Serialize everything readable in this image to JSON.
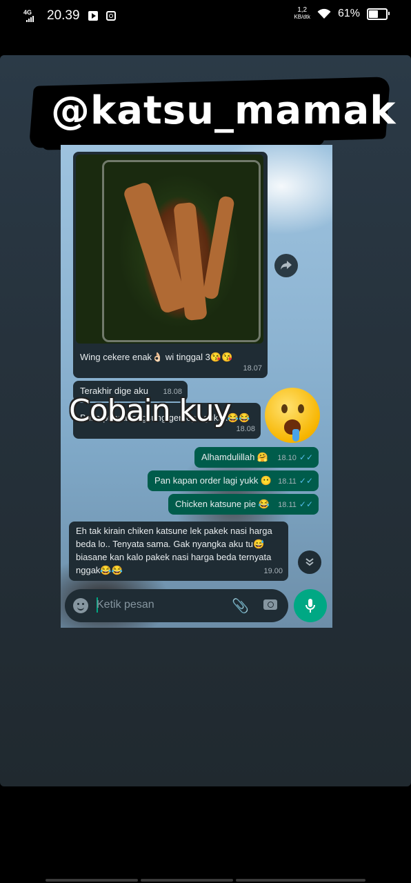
{
  "status_bar": {
    "network": "4G",
    "time": "20.39",
    "speed_value": "1,2",
    "speed_unit": "KB/dtk",
    "battery_percent": "61%",
    "battery_level": 0.61
  },
  "story": {
    "username": "@katsu_mamak",
    "overlay_text": "Cobain kuy"
  },
  "chat": {
    "messages": [
      {
        "direction": "in",
        "text": "Wing cekere enak👌🏻 wi tinggal 3😘😘",
        "time": "18.07",
        "has_image": true
      },
      {
        "direction": "in",
        "text": "Terakhir dige aku",
        "time": "18.08"
      },
      {
        "direction": "in",
        "text": "Buka puasa langsung gercep ngukak😂😂",
        "time": "18.08"
      },
      {
        "direction": "out",
        "text": "Alhamdulillah 🤗",
        "time": "18.10"
      },
      {
        "direction": "out",
        "text": "Pan kapan order lagi yukk 😶",
        "time": "18.11"
      },
      {
        "direction": "out",
        "text": "Chicken katsune pie 😂",
        "time": "18.11"
      },
      {
        "direction": "in",
        "text": "Eh tak kirain chiken katsune lek pakek nasi harga beda lo.. Tenyata sama. Gak nyangka aku tu😅 biasane kan kalo pakek nasi harga beda ternyata nggak😂😂",
        "time": "19.00"
      }
    ],
    "input_placeholder": "Ketik pesan",
    "icons": {
      "forward": "forward-icon",
      "scroll_down": "double-chevron-down-icon",
      "emoji": "emoji-icon",
      "attach": "paperclip-icon",
      "camera": "camera-icon",
      "mic": "microphone-icon"
    }
  },
  "colors": {
    "incoming_bubble": "#1f2c34",
    "outgoing_bubble": "#005c4b",
    "accent": "#00a884",
    "read_ticks": "#53bdeb"
  }
}
